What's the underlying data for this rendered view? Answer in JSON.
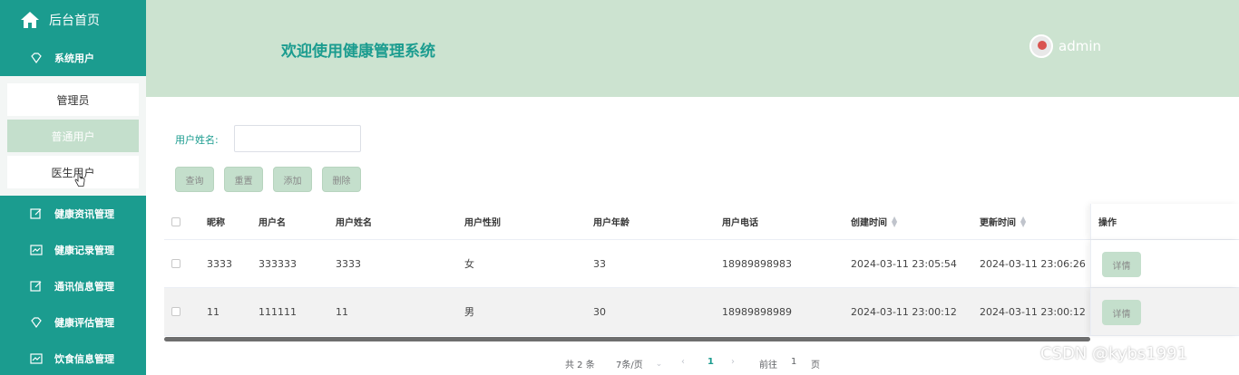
{
  "sidebar": {
    "home_label": "后台首页",
    "system_user": {
      "label": "系统用户",
      "items": [
        "管理员",
        "普通用户",
        "医生用户"
      ]
    },
    "menus": [
      "健康资讯管理",
      "健康记录管理",
      "通讯信息管理",
      "健康评估管理",
      "饮食信息管理"
    ]
  },
  "header": {
    "title": "欢迎使用健康管理系统",
    "username": "admin"
  },
  "search": {
    "label": "用户姓名:",
    "value": "",
    "placeholder": ""
  },
  "buttons": {
    "query": "查询",
    "reset": "重置",
    "add": "添加",
    "delete": "删除"
  },
  "table": {
    "headers": {
      "nickname": "昵称",
      "username": "用户名",
      "realname": "用户姓名",
      "gender": "用户性别",
      "age": "用户年龄",
      "phone": "用户电话",
      "created": "创建时间",
      "updated": "更新时间",
      "action": "操作"
    },
    "rows": [
      {
        "nickname": "3333",
        "username": "333333",
        "realname": "3333",
        "gender": "女",
        "age": "33",
        "phone": "18989898983",
        "created": "2024-03-11 23:05:54",
        "updated": "2024-03-11 23:06:26",
        "action": "详情"
      },
      {
        "nickname": "11",
        "username": "111111",
        "realname": "11",
        "gender": "男",
        "age": "30",
        "phone": "18989898989",
        "created": "2024-03-11 23:00:12",
        "updated": "2024-03-11 23:00:12",
        "action": "详情"
      }
    ]
  },
  "pagination": {
    "total": "共 2 条",
    "page_size": "7条/页",
    "current_page": "1",
    "goto_label": "前往",
    "jump_value": "1",
    "page_unit": "页"
  },
  "watermark": "CSDN @kybs1991",
  "colors": {
    "sidebar": "#1b9c8f",
    "header": "#cce3d0",
    "accent": "#1b9c8f",
    "button": "#c4dfcc"
  }
}
